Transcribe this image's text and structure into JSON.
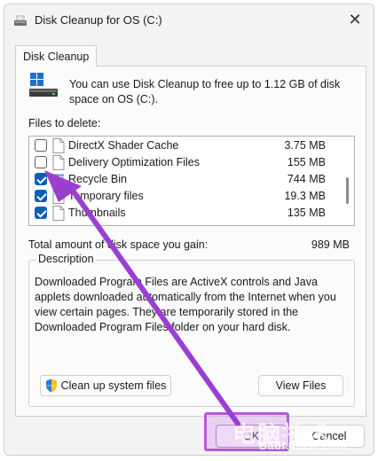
{
  "window": {
    "title": "Disk Cleanup for OS (C:)",
    "close_glyph": "✕",
    "icon": "disk-cleanup-icon"
  },
  "tab": {
    "label": "Disk Cleanup"
  },
  "intro": {
    "text": "You can use Disk Cleanup to free up to 1.12 GB of disk space on OS (C:).",
    "icon": "drive-icon"
  },
  "files": {
    "label": "Files to delete:",
    "items": [
      {
        "name": "DirectX Shader Cache",
        "size": "3.75 MB",
        "checked": false,
        "icon": "file-icon"
      },
      {
        "name": "Delivery Optimization Files",
        "size": "155 MB",
        "checked": false,
        "icon": "file-icon"
      },
      {
        "name": "Recycle Bin",
        "size": "744 MB",
        "checked": true,
        "icon": "recycle-bin-icon"
      },
      {
        "name": "Temporary files",
        "size": "19.3 MB",
        "checked": true,
        "icon": "file-icon"
      },
      {
        "name": "Thumbnails",
        "size": "135 MB",
        "checked": true,
        "icon": "file-icon"
      }
    ]
  },
  "total": {
    "label": "Total amount of disk space you gain:",
    "value": "989 MB"
  },
  "description": {
    "legend": "Description",
    "text": "Downloaded Program Files are ActiveX controls and Java applets downloaded automatically from the Internet when you view certain pages. They are temporarily stored in the Downloaded Program Files folder on your hard disk."
  },
  "buttons": {
    "cleanup_system": "Clean up system files",
    "view_files": "View Files",
    "ok": "OK",
    "cancel": "Cancel"
  },
  "annotation": {
    "accent": "#9b3fd1",
    "highlight_color": "#b25ad8"
  },
  "watermark": {
    "text": "电脑技术",
    "sub": "Badishost.com"
  },
  "colors": {
    "checkbox_accent": "#0d5fb8",
    "window_bg": "#f3f3f3"
  }
}
